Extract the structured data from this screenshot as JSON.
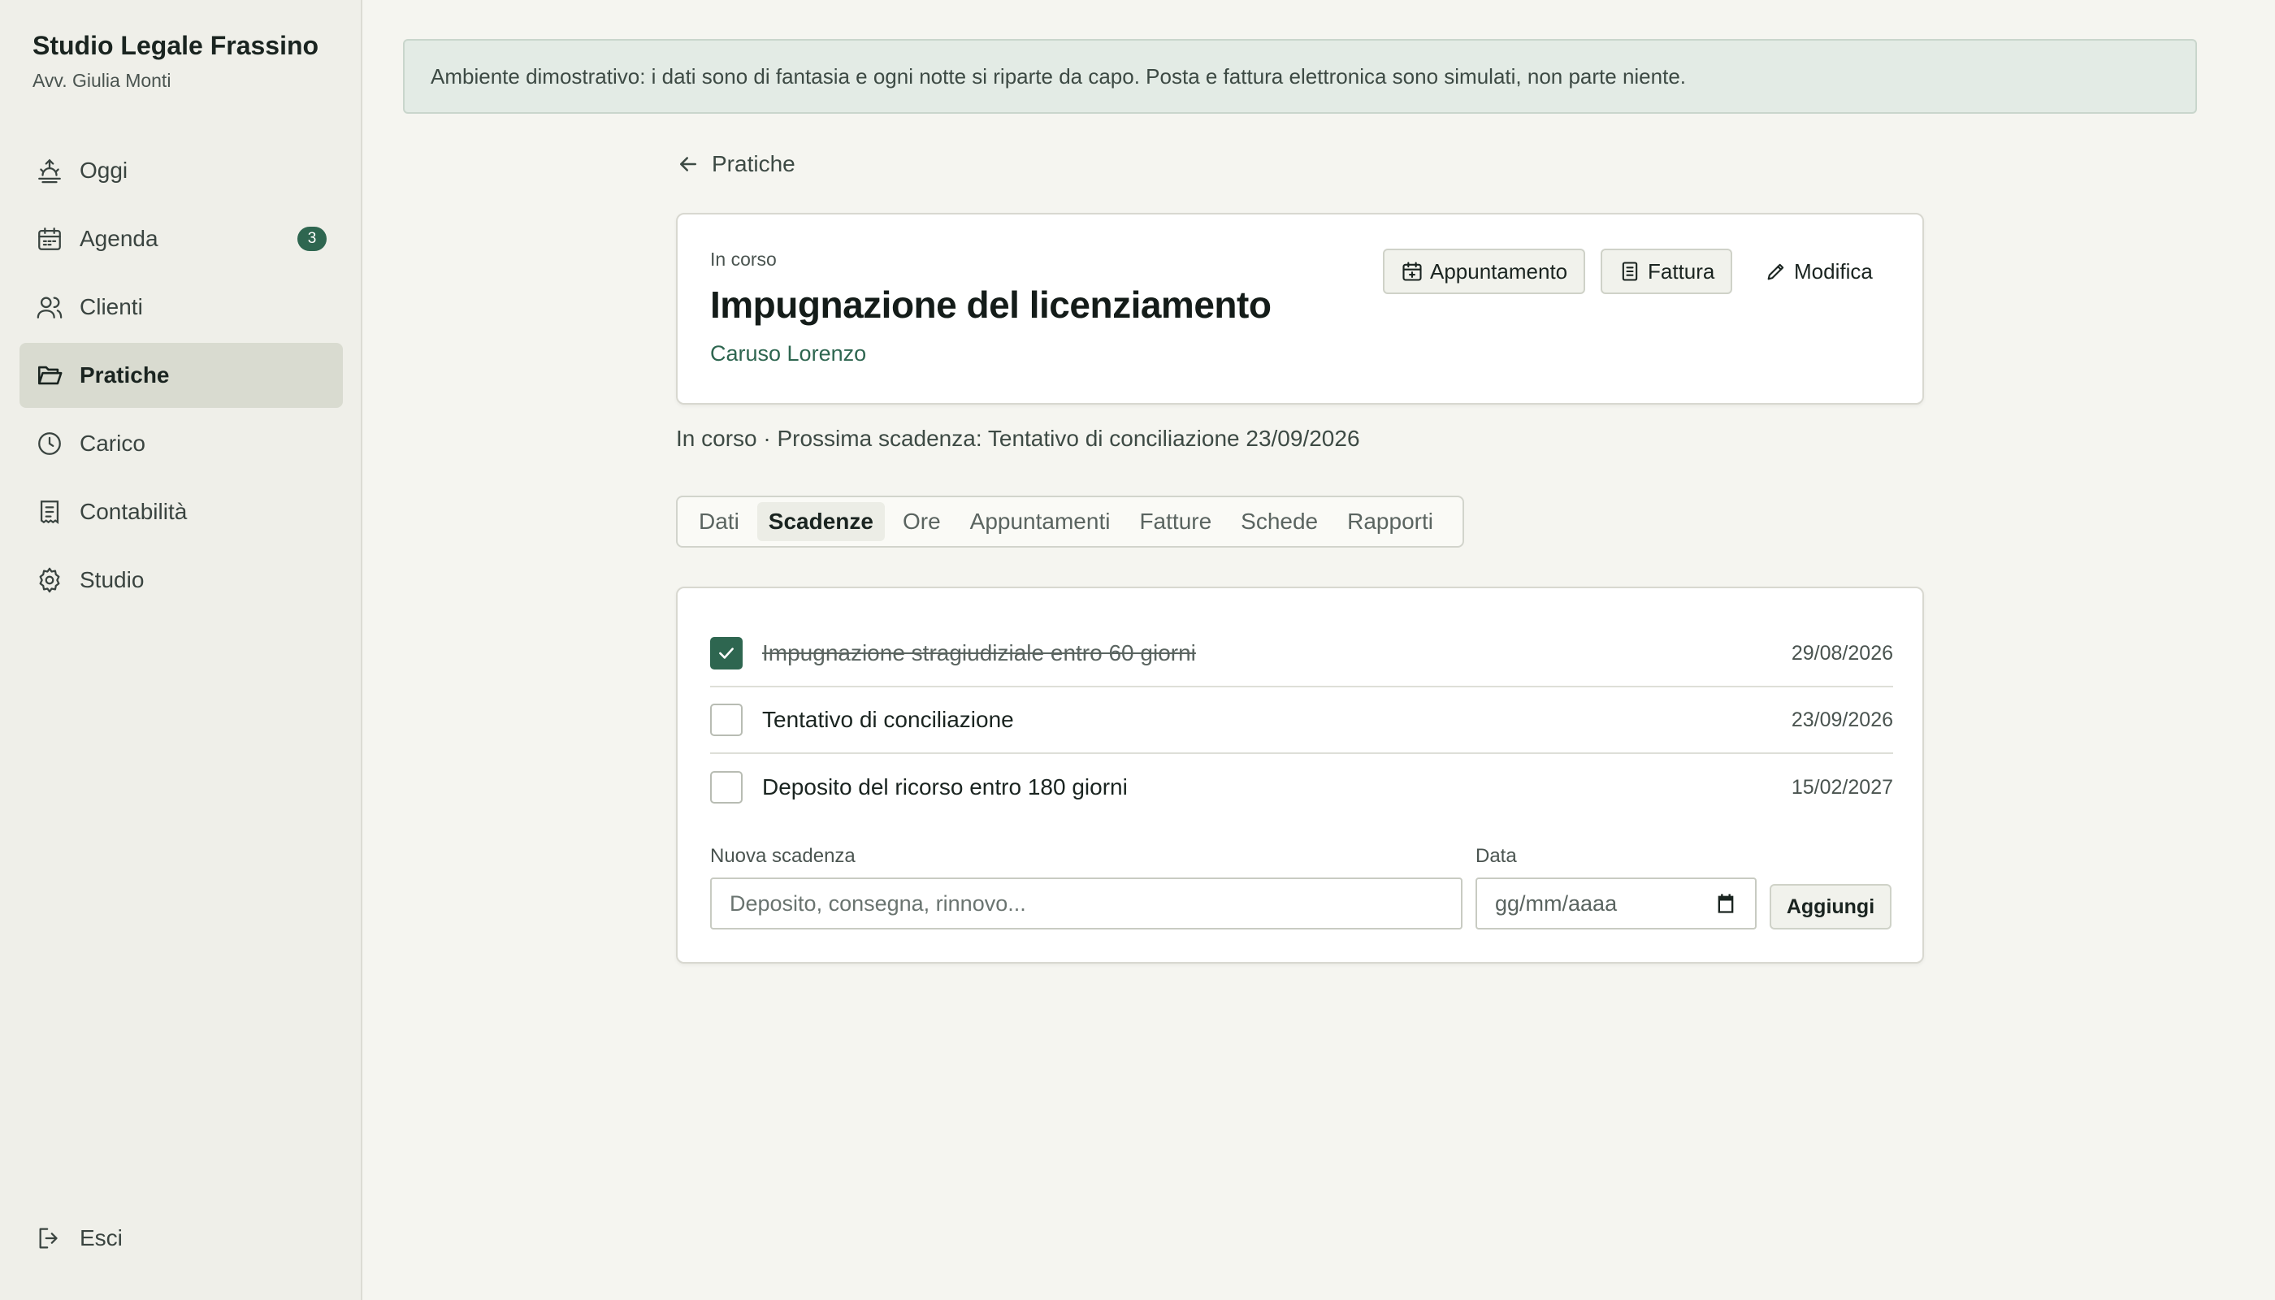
{
  "sidebar": {
    "firm_name": "Studio Legale Frassino",
    "lawyer": "Avv. Giulia Monti",
    "items": [
      {
        "label": "Oggi",
        "icon": "sunrise-icon"
      },
      {
        "label": "Agenda",
        "icon": "calendar-icon",
        "badge": "3"
      },
      {
        "label": "Clienti",
        "icon": "users-icon"
      },
      {
        "label": "Pratiche",
        "icon": "folder-open-icon",
        "active": true
      },
      {
        "label": "Carico",
        "icon": "clock-icon"
      },
      {
        "label": "Contabilità",
        "icon": "receipt-icon"
      },
      {
        "label": "Studio",
        "icon": "gear-icon"
      }
    ],
    "logout": "Esci"
  },
  "banner": "Ambiente dimostrativo: i dati sono di fantasia e ogni notte si riparte da capo. Posta e fattura elettronica sono simulati, non parte niente.",
  "back_label": "Pratiche",
  "matter": {
    "status": "In corso",
    "title": "Impugnazione del licenziamento",
    "client": "Caruso Lorenzo",
    "buttons": {
      "appointment": "Appuntamento",
      "invoice": "Fattura",
      "edit": "Modifica"
    },
    "summary": "In corso · Prossima scadenza: Tentativo di conciliazione 23/09/2026"
  },
  "tabs": [
    "Dati",
    "Scadenze",
    "Ore",
    "Appuntamenti",
    "Fatture",
    "Schede",
    "Rapporti"
  ],
  "active_tab": "Scadenze",
  "deadlines": [
    {
      "label": "Impugnazione stragiudiziale entro 60 giorni",
      "date": "29/08/2026",
      "done": true
    },
    {
      "label": "Tentativo di conciliazione",
      "date": "23/09/2026",
      "done": false
    },
    {
      "label": "Deposito del ricorso entro 180 giorni",
      "date": "15/02/2027",
      "done": false
    }
  ],
  "new_deadline": {
    "label": "Nuova scadenza",
    "placeholder": "Deposito, consegna, rinnovo...",
    "date_label": "Data",
    "date_placeholder": "gg/mm/aaaa",
    "add_label": "Aggiungi"
  },
  "colors": {
    "accent": "#2e6650",
    "sidebar_bg": "#efefe9",
    "banner_bg": "#e3ebe5"
  }
}
